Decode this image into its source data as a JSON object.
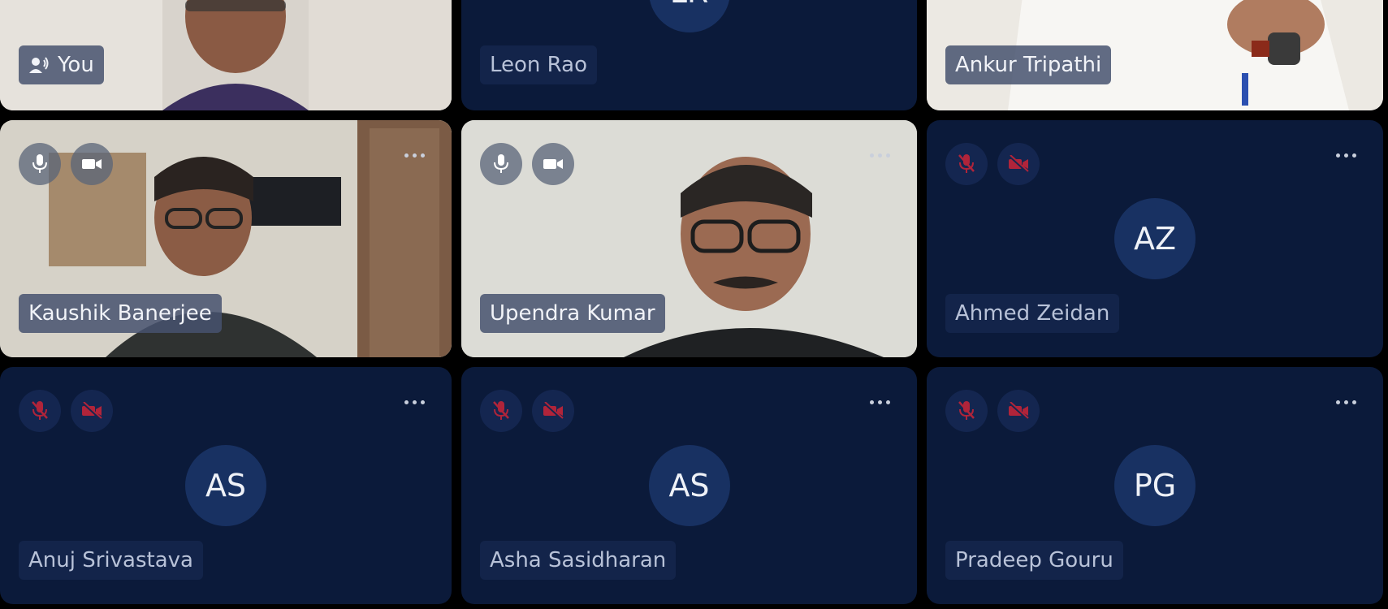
{
  "participants": [
    {
      "name": "You",
      "type": "video",
      "speaking": true
    },
    {
      "name": "Leon Rao",
      "type": "avatar",
      "initials": "LR"
    },
    {
      "name": "Ankur Tripathi",
      "type": "video"
    },
    {
      "name": "Kaushik Banerjee",
      "type": "video",
      "mic": "on",
      "camera": "on"
    },
    {
      "name": "Upendra Kumar",
      "type": "video",
      "mic": "on",
      "camera": "on"
    },
    {
      "name": "Ahmed Zeidan",
      "type": "avatar",
      "initials": "AZ",
      "mic": "muted",
      "camera": "off"
    },
    {
      "name": "Anuj Srivastava",
      "type": "avatar",
      "initials": "AS",
      "mic": "muted",
      "camera": "off"
    },
    {
      "name": "Asha Sasidharan",
      "type": "avatar",
      "initials": "AS",
      "mic": "muted",
      "camera": "off"
    },
    {
      "name": "Pradeep Gouru",
      "type": "avatar",
      "initials": "PG",
      "mic": "muted",
      "camera": "off"
    }
  ],
  "colors": {
    "background": "#000000",
    "tile": "#0b1a3a",
    "avatar_circle": "#183162",
    "muted_icon": "#b0243a",
    "active_icon": "#ffffff"
  },
  "icons": {
    "speaking": "speaker-icon",
    "mic_on": "mic-icon",
    "mic_muted": "mic-off-icon",
    "cam_on": "video-camera-icon",
    "cam_off": "video-camera-off-icon",
    "more": "more-options-icon"
  }
}
